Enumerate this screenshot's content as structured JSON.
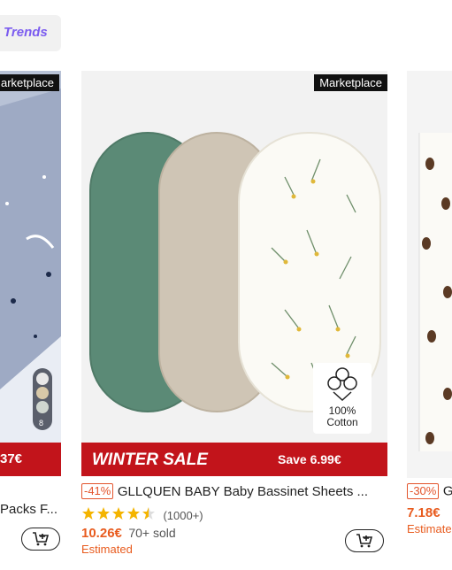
{
  "trends": {
    "label": "Trends"
  },
  "left_card": {
    "tag": "arketplace",
    "price": "37€",
    "title": "Packs F..."
  },
  "center_card": {
    "tag": "Marketplace",
    "banner_left": "WINTER SALE",
    "banner_right": "Save 6.99€",
    "badge": {
      "top": "100%",
      "bottom": "Cotton"
    },
    "discount": "-41%",
    "title": "GLLQUEN BABY Baby Bassinet Sheets ...",
    "rating_value": 4.5,
    "rating_count": "(1000+)",
    "price": "10.26€",
    "sold": "70+ sold",
    "estimated": "Estimated"
  },
  "right_card": {
    "discount": "-30%",
    "title": "G",
    "price": "7.18€",
    "estimated": "Estimate"
  },
  "colors": {
    "accent_red": "#c2141b",
    "price_orange": "#e85b1e",
    "trends_purple": "#7b5cf0"
  }
}
